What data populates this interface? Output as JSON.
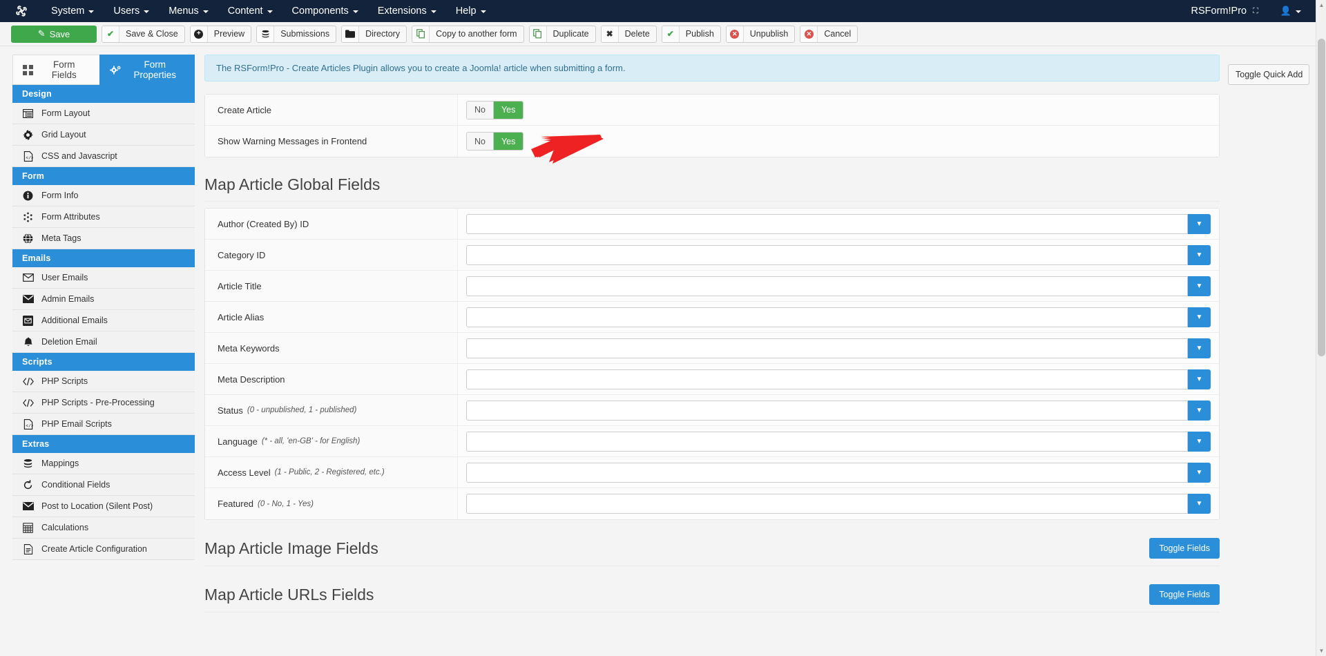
{
  "adminbar": {
    "logo_icon": "joomla-logo-icon",
    "menus": [
      {
        "label": "System",
        "has_caret": true
      },
      {
        "label": "Users",
        "has_caret": true
      },
      {
        "label": "Menus",
        "has_caret": true
      },
      {
        "label": "Content",
        "has_caret": true
      },
      {
        "label": "Components",
        "has_caret": true
      },
      {
        "label": "Extensions",
        "has_caret": true
      },
      {
        "label": "Help",
        "has_caret": true
      }
    ],
    "site_name": "RSForm!Pro",
    "site_link_icon": "external-link-icon",
    "user_icon": "user-icon",
    "user_caret": true
  },
  "toolbar": {
    "save": {
      "label": "Save",
      "icon": "save-pencil-icon"
    },
    "buttons": [
      {
        "label": "Save & Close",
        "icon": "check-icon"
      },
      {
        "label": "Preview",
        "icon": "plus-circle-icon"
      },
      {
        "label": "Submissions",
        "icon": "database-icon"
      },
      {
        "label": "Directory",
        "icon": "folder-icon"
      },
      {
        "label": "Copy to another form",
        "icon": "copy-icon"
      },
      {
        "label": "Duplicate",
        "icon": "copy-icon"
      },
      {
        "label": "Delete",
        "icon": "x-icon"
      },
      {
        "label": "Publish",
        "icon": "check-icon"
      },
      {
        "label": "Unpublish",
        "icon": "cancel-circle-icon"
      },
      {
        "label": "Cancel",
        "icon": "cancel-circle-icon"
      }
    ]
  },
  "tabs": [
    {
      "label": "Form Fields",
      "icon": "grid-icon",
      "active": false
    },
    {
      "label": "Form Properties",
      "icon": "gears-icon",
      "active": true
    }
  ],
  "sidebar": {
    "groups": [
      {
        "title": "Design",
        "items": [
          {
            "label": "Form Layout",
            "icon": "layout-icon"
          },
          {
            "label": "Grid Layout",
            "icon": "gear-icon"
          },
          {
            "label": "CSS and Javascript",
            "icon": "code-file-icon"
          }
        ]
      },
      {
        "title": "Form",
        "items": [
          {
            "label": "Form Info",
            "icon": "info-icon"
          },
          {
            "label": "Form Attributes",
            "icon": "dots-icon"
          },
          {
            "label": "Meta Tags",
            "icon": "globe-icon"
          }
        ]
      },
      {
        "title": "Emails",
        "items": [
          {
            "label": "User Emails",
            "icon": "envelope-outline-icon"
          },
          {
            "label": "Admin Emails",
            "icon": "envelope-solid-icon"
          },
          {
            "label": "Additional Emails",
            "icon": "envelope-square-icon"
          },
          {
            "label": "Deletion Email",
            "icon": "bell-icon"
          }
        ]
      },
      {
        "title": "Scripts",
        "items": [
          {
            "label": "PHP Scripts",
            "icon": "code-icon"
          },
          {
            "label": "PHP Scripts - Pre-Processing",
            "icon": "code-icon"
          },
          {
            "label": "PHP Email Scripts",
            "icon": "code-file-icon"
          }
        ]
      },
      {
        "title": "Extras",
        "items": [
          {
            "label": "Mappings",
            "icon": "database-icon"
          },
          {
            "label": "Conditional Fields",
            "icon": "refresh-icon"
          },
          {
            "label": "Post to Location (Silent Post)",
            "icon": "envelope-solid-icon"
          },
          {
            "label": "Calculations",
            "icon": "calculator-icon"
          },
          {
            "label": "Create Article Configuration",
            "icon": "file-text-icon"
          }
        ]
      }
    ]
  },
  "main": {
    "notice": "The RSForm!Pro - Create Articles Plugin allows you to create a Joomla! article when submitting a form.",
    "quick_add_label": "Toggle Quick Add",
    "toggle_rows": [
      {
        "label": "Create Article",
        "off_label": "No",
        "on_label": "Yes",
        "value": "Yes"
      },
      {
        "label": "Show Warning Messages in Frontend",
        "off_label": "No",
        "on_label": "Yes",
        "value": "Yes"
      }
    ],
    "sections": [
      {
        "title": "Map Article Global Fields",
        "has_toggle_button": false,
        "toggle_label": "",
        "rows": [
          {
            "label": "Author (Created By) ID",
            "hint": "",
            "value": "",
            "dropdown_icon": "chevron-down-icon"
          },
          {
            "label": "Category ID",
            "hint": "",
            "value": "",
            "dropdown_icon": "chevron-down-icon"
          },
          {
            "label": "Article Title",
            "hint": "",
            "value": "",
            "dropdown_icon": "chevron-down-icon"
          },
          {
            "label": "Article Alias",
            "hint": "",
            "value": "",
            "dropdown_icon": "chevron-down-icon"
          },
          {
            "label": "Meta Keywords",
            "hint": "",
            "value": "",
            "dropdown_icon": "chevron-down-icon"
          },
          {
            "label": "Meta Description",
            "hint": "",
            "value": "",
            "dropdown_icon": "chevron-down-icon"
          },
          {
            "label": "Status",
            "hint": "(0 - unpublished, 1 - published)",
            "value": "",
            "dropdown_icon": "chevron-down-icon"
          },
          {
            "label": "Language",
            "hint": "(* - all, 'en-GB' - for English)",
            "value": "",
            "dropdown_icon": "chevron-down-icon"
          },
          {
            "label": "Access Level",
            "hint": "(1 - Public, 2 - Registered, etc.)",
            "value": "",
            "dropdown_icon": "chevron-down-icon"
          },
          {
            "label": "Featured",
            "hint": "(0 - No, 1 - Yes)",
            "value": "",
            "dropdown_icon": "chevron-down-icon"
          }
        ]
      },
      {
        "title": "Map Article Image Fields",
        "has_toggle_button": true,
        "toggle_label": "Toggle Fields",
        "rows": []
      },
      {
        "title": "Map Article URLs Fields",
        "has_toggle_button": true,
        "toggle_label": "Toggle Fields",
        "rows": []
      }
    ]
  },
  "colors": {
    "adminbar_bg": "#13233c",
    "accent_blue": "#2a8fd8",
    "green": "#3ea84b",
    "toggle_on": "#4caf50",
    "notice_bg": "#d9edf7",
    "notice_text": "#31708f",
    "arrow_red": "#ee2222"
  }
}
